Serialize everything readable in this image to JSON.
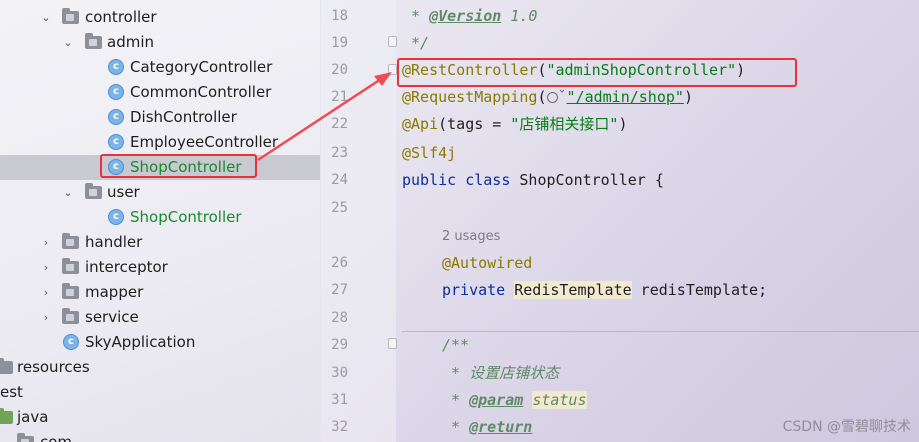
{
  "tree": {
    "rows": [
      {
        "label": "controller"
      },
      {
        "label": "admin"
      },
      {
        "label": "CategoryController"
      },
      {
        "label": "CommonController"
      },
      {
        "label": "DishController"
      },
      {
        "label": "EmployeeController"
      },
      {
        "label": "ShopController"
      },
      {
        "label": "user"
      },
      {
        "label": "ShopController"
      },
      {
        "label": "handler"
      },
      {
        "label": "interceptor"
      },
      {
        "label": "mapper"
      },
      {
        "label": "service"
      },
      {
        "label": "SkyApplication"
      },
      {
        "label": "resources"
      },
      {
        "label": "est"
      },
      {
        "label": "java"
      },
      {
        "label": "com"
      }
    ]
  },
  "editor": {
    "line_numbers": [
      "18",
      "19",
      "20",
      "21",
      "22",
      "23",
      "24",
      "25",
      "26",
      "27",
      "28",
      "29",
      "30",
      "31",
      "32"
    ],
    "lines": {
      "l18_star": " * ",
      "l18_tag": "@Version",
      "l18_rest": " 1.0",
      "l19": " */",
      "l20_ann": "@RestController",
      "l20_open": "(",
      "l20_str": "\"adminShopController\"",
      "l20_close": ")",
      "l21_ann": "@RequestMapping",
      "l21_open": "(",
      "l21_chev": "ˇ",
      "l21_str": "\"/admin/shop\"",
      "l21_close": ")",
      "l22_ann": "@Api",
      "l22_open": "(tags = ",
      "l22_str": "\"店铺相关接口\"",
      "l22_close": ")",
      "l23_ann": "@Slf4j",
      "l24_kw": "public class",
      "l24_rest": " ShopController {",
      "usages": "2 usages",
      "l26_ann": "@Autowired",
      "l27_kw": "private",
      "l27_type": "RedisTemplate",
      "l27_rest": " redisTemplate;",
      "l29": "/**",
      "l30": " * 设置店铺状态",
      "l31_star": " * ",
      "l31_tag": "@param",
      "l31_param": "status",
      "l32_star": " * ",
      "l32_tag": "@return"
    }
  },
  "watermark": "CSDN @雪碧聊技术",
  "colors": {
    "highlight_red": "#e5323b",
    "string_green": "#067d17",
    "keyword_blue": "#0b2e97",
    "annotation_olive": "#8a7a00"
  }
}
